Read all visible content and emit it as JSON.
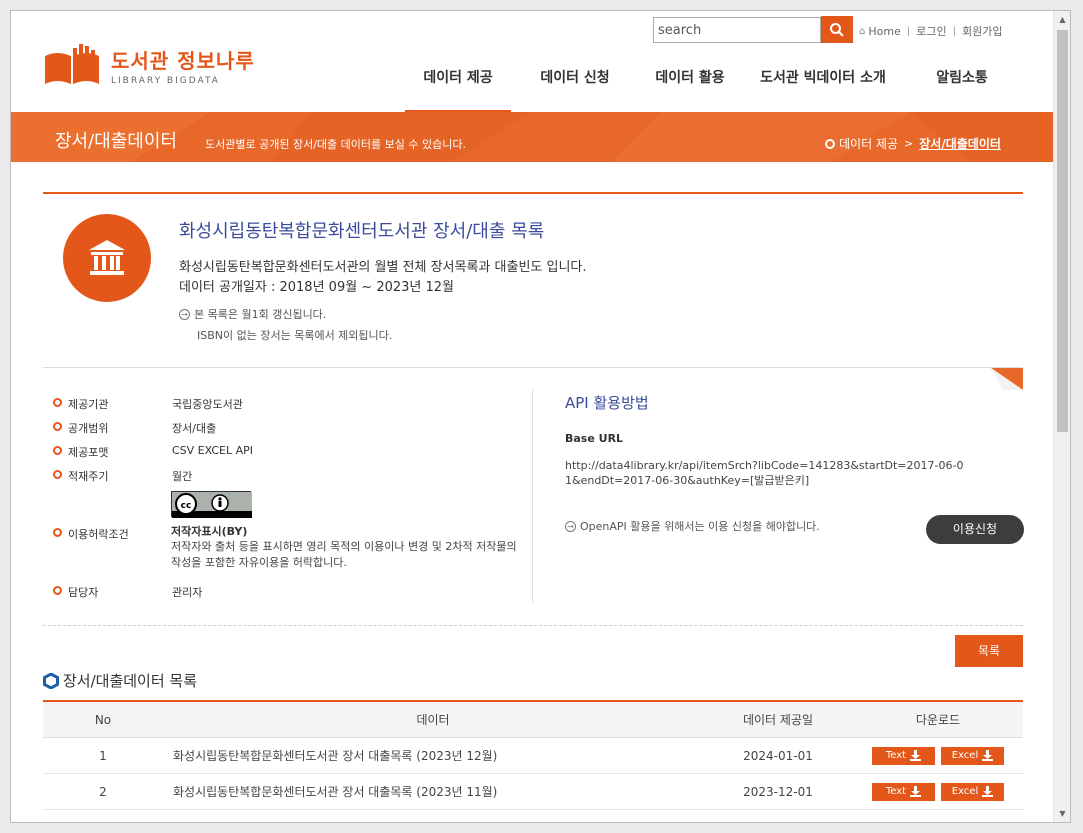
{
  "header": {
    "search_placeholder": "search",
    "links": {
      "home": "Home",
      "login": "로그인",
      "signup": "회원가입"
    },
    "logo": {
      "title": "도서관 정보나루",
      "subtitle": "LIBRARY BIGDATA"
    },
    "nav": [
      "데이터 제공",
      "데이터 신청",
      "데이터 활용",
      "도서관 빅데이터 소개",
      "알림소통"
    ],
    "active_nav": "데이터 제공"
  },
  "banner": {
    "title": "장서/대출데이터",
    "description": "도서관별로 공개된 장서/대출 데이터를 보실 수 있습니다.",
    "breadcrumb": [
      "데이터 제공",
      "장서/대출데이터"
    ]
  },
  "dataset": {
    "title": "화성시립동탄복합문화센터도서관 장서/대출 목록",
    "description": "화성시립동탄복합문화센터도서관의 월별 전체 장서목록과 대출빈도 입니다.",
    "period": "데이터 공개일자 : 2018년 09월 ~ 2023년 12월",
    "notes": [
      "본 목록은 월1회 갱신됩니다.",
      "ISBN이 없는 장서는 목록에서 제외됩니다."
    ]
  },
  "info": {
    "provider_label": "제공기관",
    "provider": "국립중앙도서관",
    "scope_label": "공개범위",
    "scope": "장서/대출",
    "format_label": "제공포맷",
    "format": "CSV EXCEL API",
    "cycle_label": "적재주기",
    "cycle": "월간",
    "license_label": "이용허락조건",
    "license_title": "저작자표시(BY)",
    "license_desc": "저작자와 출처 등을 표시하면 영리 목적의 이용이나 변경 및 2차적 저작물의 작성을 포함한 자유이용을 허락합니다.",
    "manager_label": "담당자",
    "manager": "관리자"
  },
  "api": {
    "title": "API 활용방법",
    "base_label": "Base URL",
    "url": "http://data4library.kr/api/itemSrch?libCode=141283&startDt=2017-06-01&endDt=2017-06-30&authKey=[발급받은키]",
    "note": "OpenAPI 활용을 위해서는 이용 신청을 해야합니다.",
    "apply_label": "이용신청"
  },
  "list": {
    "button": "목록",
    "section_title": "장서/대출데이터 목록",
    "columns": [
      "No",
      "데이터",
      "데이터 제공일",
      "다운로드"
    ],
    "rows": [
      {
        "no": "1",
        "name": "화성시립동탄복합문화센터도서관 장서 대출목록 (2023년 12월)",
        "date": "2024-01-01"
      },
      {
        "no": "2",
        "name": "화성시립동탄복합문화센터도서관 장서 대출목록 (2023년 11월)",
        "date": "2023-12-01"
      }
    ],
    "dl_text": "Text",
    "dl_excel": "Excel"
  },
  "colors": {
    "accent": "#e4571a",
    "title_blue": "#3b4c9c"
  }
}
